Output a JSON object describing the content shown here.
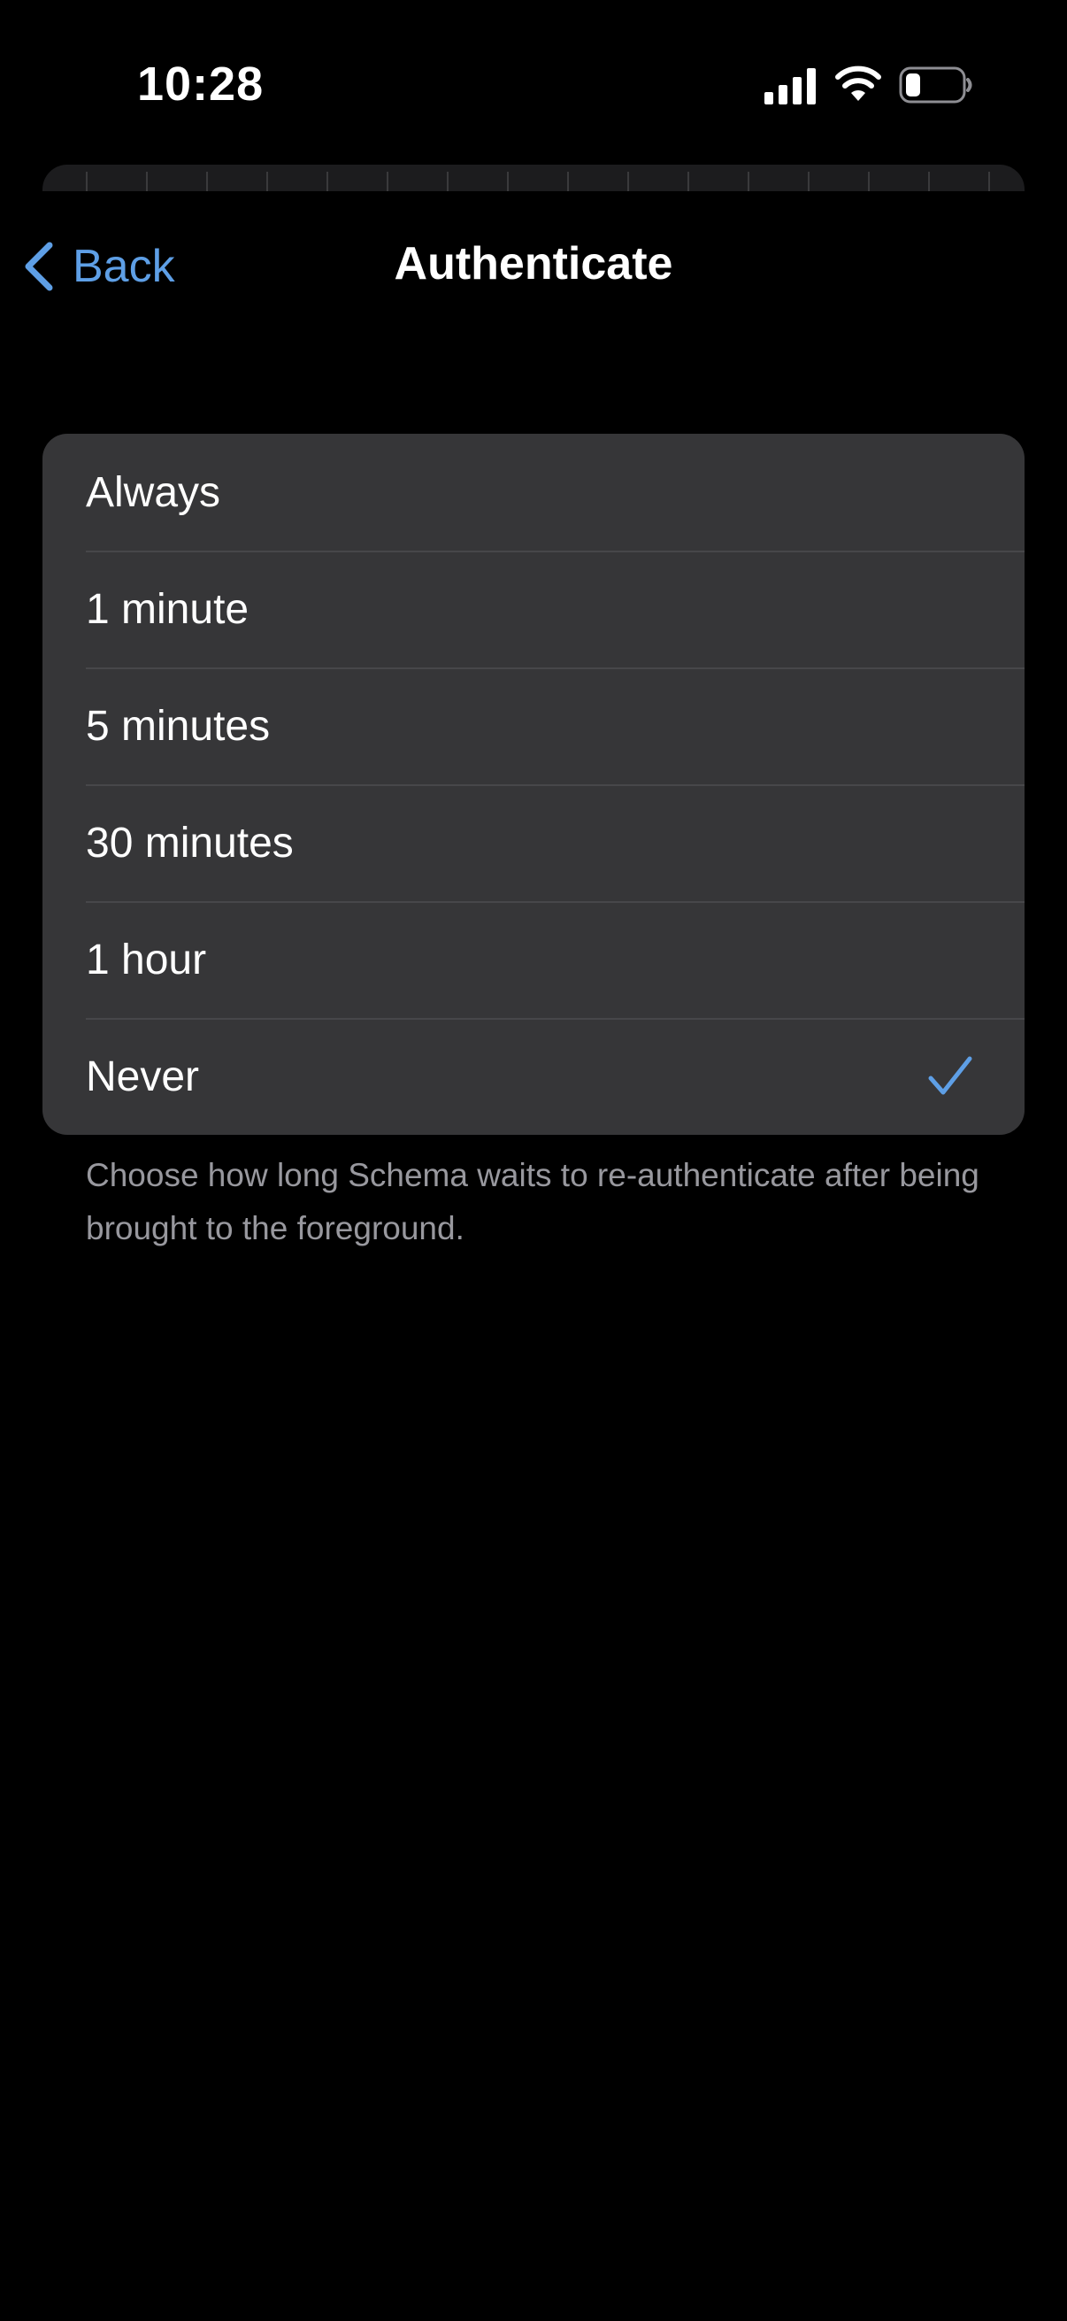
{
  "status_bar": {
    "time": "10:28",
    "signal_icon": "cellular-signal-icon",
    "wifi_icon": "wifi-icon",
    "battery_icon": "battery-low-icon"
  },
  "nav": {
    "back_label": "Back",
    "back_icon": "chevron-left-icon",
    "title": "Authenticate"
  },
  "options": [
    {
      "label": "Always",
      "selected": false
    },
    {
      "label": "1 minute",
      "selected": false
    },
    {
      "label": "5 minutes",
      "selected": false
    },
    {
      "label": "30 minutes",
      "selected": false
    },
    {
      "label": "1 hour",
      "selected": false
    },
    {
      "label": "Never",
      "selected": true
    }
  ],
  "footer": {
    "text": "Choose how long Schema waits to re-authenticate after being brought to the foreground."
  },
  "colors": {
    "background": "#000000",
    "accent": "#5e9fe6",
    "cell_background": "#363638",
    "secondary_text": "#98989e"
  }
}
